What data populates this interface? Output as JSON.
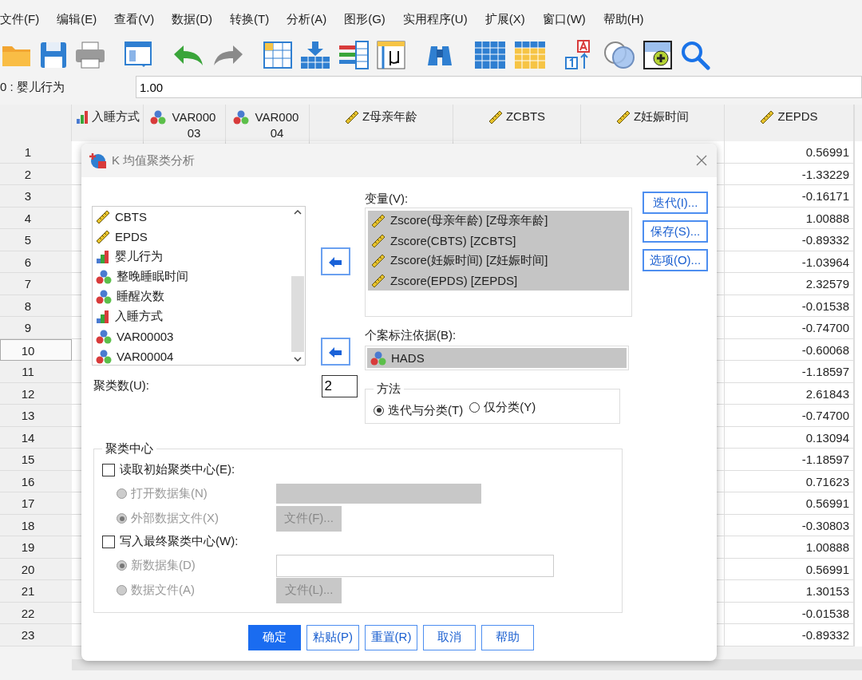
{
  "menu": [
    "文件(F)",
    "编辑(E)",
    "查看(V)",
    "数据(D)",
    "转换(T)",
    "分析(A)",
    "图形(G)",
    "实用程序(U)",
    "扩展(X)",
    "窗口(W)",
    "帮助(H)"
  ],
  "cell_editor": {
    "cell_ref": "0 : 婴儿行为",
    "value": "1.00"
  },
  "grid": {
    "columns": [
      {
        "name": "入睡方式",
        "kind": "ordinal"
      },
      {
        "name": "VAR00003",
        "kind": "nominal"
      },
      {
        "name": "VAR00004",
        "kind": "nominal"
      },
      {
        "name": "Z母亲年龄",
        "kind": "scale"
      },
      {
        "name": "ZCBTS",
        "kind": "scale"
      },
      {
        "name": "Z妊娠时间",
        "kind": "scale"
      },
      {
        "name": "ZEPDS",
        "kind": "scale"
      }
    ],
    "rows": [
      {
        "num": "1",
        "selected": false,
        "zepds": "0.56991"
      },
      {
        "num": "2",
        "selected": false,
        "zepds": "-1.33229"
      },
      {
        "num": "3",
        "selected": false,
        "zepds": "-0.16171"
      },
      {
        "num": "4",
        "selected": false,
        "zepds": "1.00888"
      },
      {
        "num": "5",
        "selected": false,
        "zepds": "-0.89332"
      },
      {
        "num": "6",
        "selected": false,
        "zepds": "-1.03964"
      },
      {
        "num": "7",
        "selected": false,
        "zepds": "2.32579"
      },
      {
        "num": "8",
        "selected": false,
        "zepds": "-0.01538"
      },
      {
        "num": "9",
        "selected": false,
        "zepds": "-0.74700"
      },
      {
        "num": "10",
        "selected": true,
        "zepds": "-0.60068"
      },
      {
        "num": "11",
        "selected": false,
        "zepds": "-1.18597"
      },
      {
        "num": "12",
        "selected": false,
        "zepds": "2.61843"
      },
      {
        "num": "13",
        "selected": false,
        "zepds": "-0.74700"
      },
      {
        "num": "14",
        "selected": false,
        "zepds": "0.13094"
      },
      {
        "num": "15",
        "selected": false,
        "zepds": "-1.18597"
      },
      {
        "num": "16",
        "selected": false,
        "zepds": "0.71623"
      },
      {
        "num": "17",
        "selected": false,
        "zepds": "0.56991"
      },
      {
        "num": "18",
        "selected": false,
        "zepds": "-0.30803"
      },
      {
        "num": "19",
        "selected": false,
        "zepds": "1.00888"
      },
      {
        "num": "20",
        "selected": false,
        "zepds": "0.56991"
      },
      {
        "num": "21",
        "selected": false,
        "zepds": "1.30153"
      },
      {
        "num": "22",
        "selected": false,
        "zepds": "-0.01538"
      },
      {
        "num": "23",
        "selected": false,
        "zepds": "-0.89332"
      }
    ]
  },
  "dialog": {
    "title": "K 均值聚类分析",
    "source_list": [
      {
        "label": "CBTS",
        "kind": "scale"
      },
      {
        "label": "EPDS",
        "kind": "scale"
      },
      {
        "label": "婴儿行为",
        "kind": "ordinal"
      },
      {
        "label": "整晚睡眠时间",
        "kind": "nominal"
      },
      {
        "label": "睡醒次数",
        "kind": "nominal"
      },
      {
        "label": "入睡方式",
        "kind": "ordinal"
      },
      {
        "label": "VAR00003",
        "kind": "nominal"
      },
      {
        "label": "VAR00004",
        "kind": "nominal"
      }
    ],
    "variables_label": "变量(V):",
    "variables": [
      {
        "label": "Zscore(母亲年龄) [Z母亲年龄]",
        "kind": "scale",
        "selected": true
      },
      {
        "label": "Zscore(CBTS) [ZCBTS]",
        "kind": "scale",
        "selected": true
      },
      {
        "label": "Zscore(妊娠时间) [Z妊娠时间]",
        "kind": "scale",
        "selected": true
      },
      {
        "label": "Zscore(EPDS) [ZEPDS]",
        "kind": "scale",
        "selected": true
      }
    ],
    "case_label": "个案标注依据(B):",
    "case_label_var": {
      "label": "HADS",
      "kind": "nominal",
      "selected": true
    },
    "side_buttons": [
      "迭代(I)...",
      "保存(S)...",
      "选项(O)..."
    ],
    "clusters_label": "聚类数(U):",
    "clusters_value": "2",
    "method": {
      "title": "方法",
      "options": [
        {
          "label": "迭代与分类(T)",
          "selected": true
        },
        {
          "label": "仅分类(Y)",
          "selected": false
        }
      ]
    },
    "centers": {
      "title": "聚类中心",
      "groups": [
        {
          "label": "读取初始聚类中心(E):",
          "checked": false,
          "options": [
            {
              "label": "打开数据集(N)",
              "selected": false,
              "disabled": true,
              "kind": "dropdown"
            },
            {
              "label": "外部数据文件(X)",
              "selected": true,
              "disabled": true,
              "kind": "file",
              "button": "文件(F)..."
            }
          ]
        },
        {
          "label": "写入最终聚类中心(W):",
          "checked": false,
          "options": [
            {
              "label": "新数据集(D)",
              "selected": true,
              "disabled": true,
              "kind": "text"
            },
            {
              "label": "数据文件(A)",
              "selected": false,
              "disabled": true,
              "kind": "file",
              "button": "文件(L)..."
            }
          ]
        }
      ]
    },
    "footer_buttons": [
      {
        "label": "确定",
        "kind": "primary"
      },
      {
        "label": "粘贴(P)",
        "kind": "normal"
      },
      {
        "label": "重置(R)",
        "kind": "normal"
      },
      {
        "label": "取消",
        "kind": "normal"
      },
      {
        "label": "帮助",
        "kind": "normal"
      }
    ]
  }
}
